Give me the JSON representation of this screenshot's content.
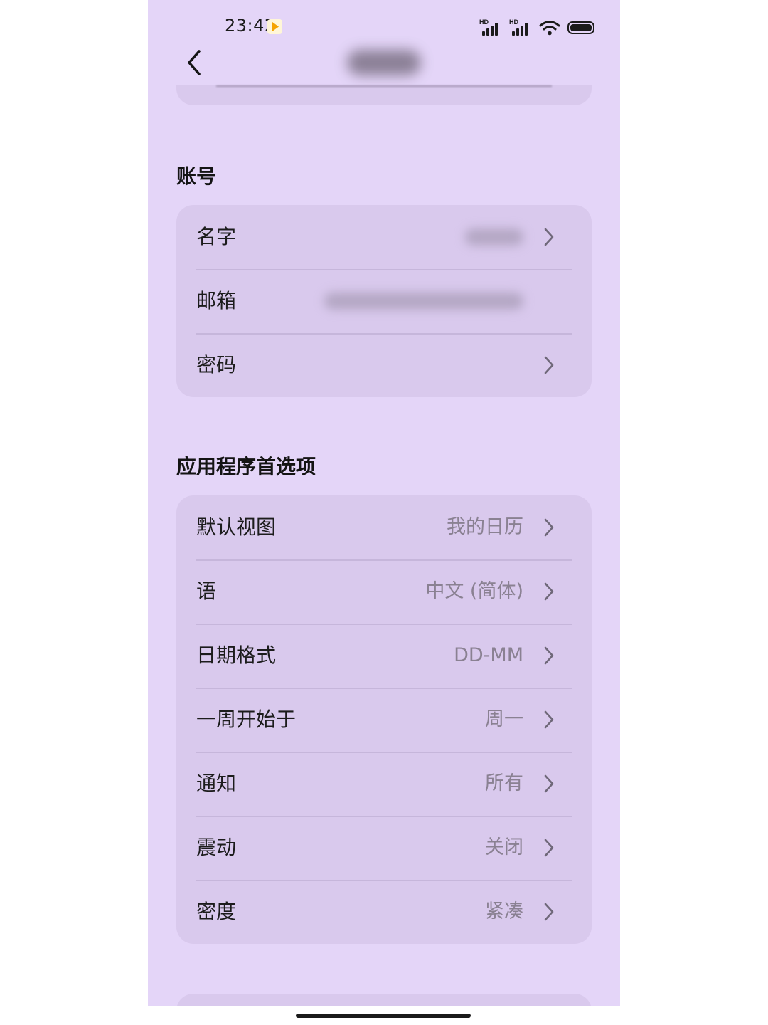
{
  "status_bar": {
    "time": "23:42",
    "signal_badge_1": "HD",
    "signal_badge_2": "HD",
    "icons": [
      "video-play-icon",
      "signal-icon",
      "signal-icon",
      "wifi-icon",
      "battery-icon"
    ]
  },
  "nav": {
    "back_icon": "chevron-left-icon"
  },
  "account": {
    "title": "账号",
    "rows": [
      {
        "label": "名字",
        "value": ""
      },
      {
        "label": "邮箱",
        "value": ""
      },
      {
        "label": "密码",
        "value": ""
      }
    ]
  },
  "preferences": {
    "title": "应用程序首选项",
    "rows": [
      {
        "label": "默认视图",
        "value": "我的日历"
      },
      {
        "label": "语",
        "value": "中文 (简体)"
      },
      {
        "label": "日期格式",
        "value": "DD-MM"
      },
      {
        "label": "一周开始于",
        "value": "周一"
      },
      {
        "label": "通知",
        "value": "所有"
      },
      {
        "label": "震动",
        "value": "关闭"
      },
      {
        "label": "密度",
        "value": "紧凑"
      }
    ]
  },
  "colors": {
    "background": "#e4d5f8",
    "card": "#d9c9ed",
    "label": "#1c1c1c",
    "value": "#8a8192"
  }
}
